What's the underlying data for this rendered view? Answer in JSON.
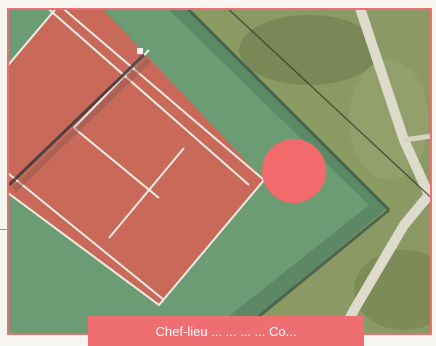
{
  "map": {
    "view": "aerial satellite imagery",
    "subject": "tennis court",
    "colors": {
      "court_surface": "#c8695a",
      "court_surround": "#6c9c74",
      "terrain": "#8b9a64",
      "path": "#dedbcd",
      "frame_border": "#ec6f71"
    }
  },
  "marker": {
    "shape": "circle",
    "color": "#f26a6c"
  },
  "caption": {
    "text": "Chef-lieu ... ... ... ... Co...",
    "color": "#ef6e72",
    "text_color": "#ffffff"
  }
}
